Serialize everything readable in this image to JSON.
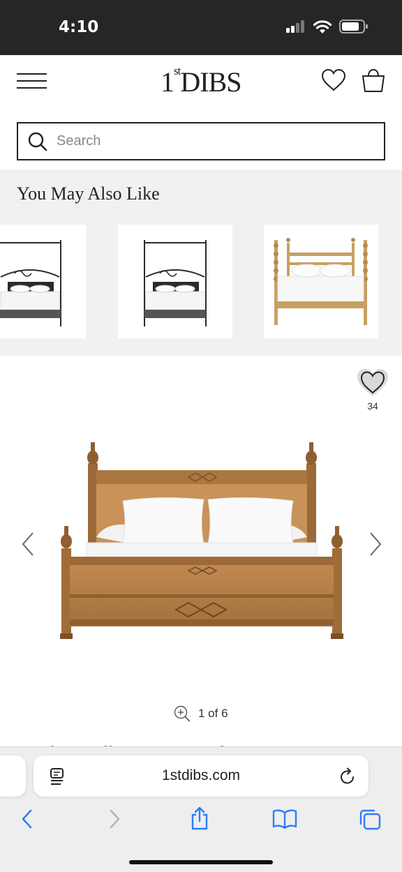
{
  "status_bar": {
    "time": "4:10",
    "icons": [
      "cellular-signal-icon",
      "wifi-icon",
      "battery-icon"
    ]
  },
  "header": {
    "logo": {
      "main": "1",
      "sup": "st",
      "rest": "DIBS"
    },
    "icons": [
      "hamburger-menu-icon",
      "heart-icon",
      "shopping-bag-icon"
    ]
  },
  "search": {
    "placeholder": "Search",
    "value": ""
  },
  "recommendations": {
    "title": "You May Also Like",
    "items": [
      {
        "icon": "iron-canopy-bed-image"
      },
      {
        "icon": "iron-canopy-bed-image"
      },
      {
        "icon": "spindle-post-bed-image"
      }
    ]
  },
  "product": {
    "favorite_count": "34",
    "image_icon": "wooden-bamboo-bed-image",
    "pager": {
      "text": "1 of 6",
      "icon": "zoom-in-icon"
    },
    "title_partial": "Bamboo William Henry Bed"
  },
  "browser": {
    "url": "1stdibs.com",
    "icons": [
      "reader-icon",
      "reload-icon",
      "back-icon",
      "forward-icon",
      "share-icon",
      "bookmarks-icon",
      "tabs-icon"
    ]
  },
  "colors": {
    "dark": "#222222",
    "status_bar_bg": "#262626",
    "section_bg": "#f1f1f1",
    "ios_blue": "#2f7cf6",
    "wood": "#b07a45"
  }
}
